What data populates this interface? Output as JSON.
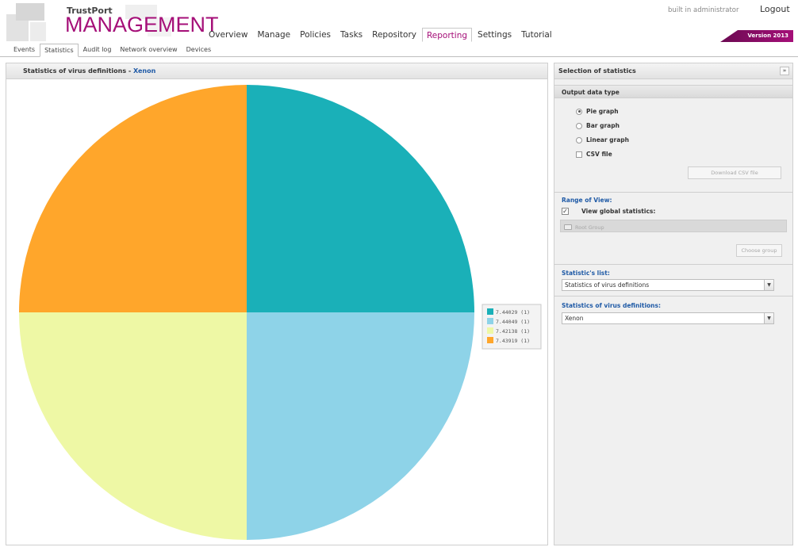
{
  "brand": {
    "company": "TrustPort",
    "product": "MANAGEMENT"
  },
  "top_nav": {
    "items": [
      {
        "label": "Overview",
        "active": false
      },
      {
        "label": "Manage",
        "active": false
      },
      {
        "label": "Policies",
        "active": false
      },
      {
        "label": "Tasks",
        "active": false
      },
      {
        "label": "Repository",
        "active": false
      },
      {
        "label": "Reporting",
        "active": true
      },
      {
        "label": "Settings",
        "active": false
      },
      {
        "label": "Tutorial",
        "active": false
      }
    ]
  },
  "user": {
    "info": "built in administrator",
    "logout_label": "Logout",
    "version_label": "Version 2013"
  },
  "sub_nav": {
    "items": [
      {
        "label": "Events",
        "active": false
      },
      {
        "label": "Statistics",
        "active": true
      },
      {
        "label": "Audit log",
        "active": false
      },
      {
        "label": "Network overview",
        "active": false
      },
      {
        "label": "Devices",
        "active": false
      }
    ]
  },
  "chart_panel": {
    "title": "Statistics of virus definitions - ",
    "subject": "Xenon"
  },
  "chart_data": {
    "type": "pie",
    "categories": [
      "7.44029",
      "7.44049",
      "7.42138",
      "7.43919"
    ],
    "values": [
      1,
      1,
      1,
      1
    ],
    "legend": [
      "7.44029 (1)",
      "7.44049 (1)",
      "7.42138 (1)",
      "7.43919 (1)"
    ],
    "colors": [
      "#1ab0b8",
      "#8ed3e8",
      "#eef8a5",
      "#ffa62b"
    ],
    "legend_position": "right",
    "title": ""
  },
  "right_panel": {
    "title": "Selection of statistics",
    "collapse_label": "»",
    "output_type": {
      "header": "Output data type",
      "options": [
        {
          "label": "Pie graph",
          "checked": true,
          "kind": "radio"
        },
        {
          "label": "Bar graph",
          "checked": false,
          "kind": "radio"
        },
        {
          "label": "Linear graph",
          "checked": false,
          "kind": "radio"
        },
        {
          "label": "CSV file",
          "checked": false,
          "kind": "checkbox"
        }
      ],
      "download_button": "Download CSV file"
    },
    "range": {
      "title": "Range of View:",
      "global_label": "View global statistics:",
      "global_checked": true,
      "check_mark": "✓",
      "root_group": "Root Group",
      "choose_group_button": "Choose group"
    },
    "statistics_list": {
      "label": "Statistic's list:",
      "value": "Statistics of virus definitions"
    },
    "virus_definitions": {
      "label": "Statistics of virus definitions:",
      "value": "Xenon"
    },
    "select_arrow": "▼"
  }
}
